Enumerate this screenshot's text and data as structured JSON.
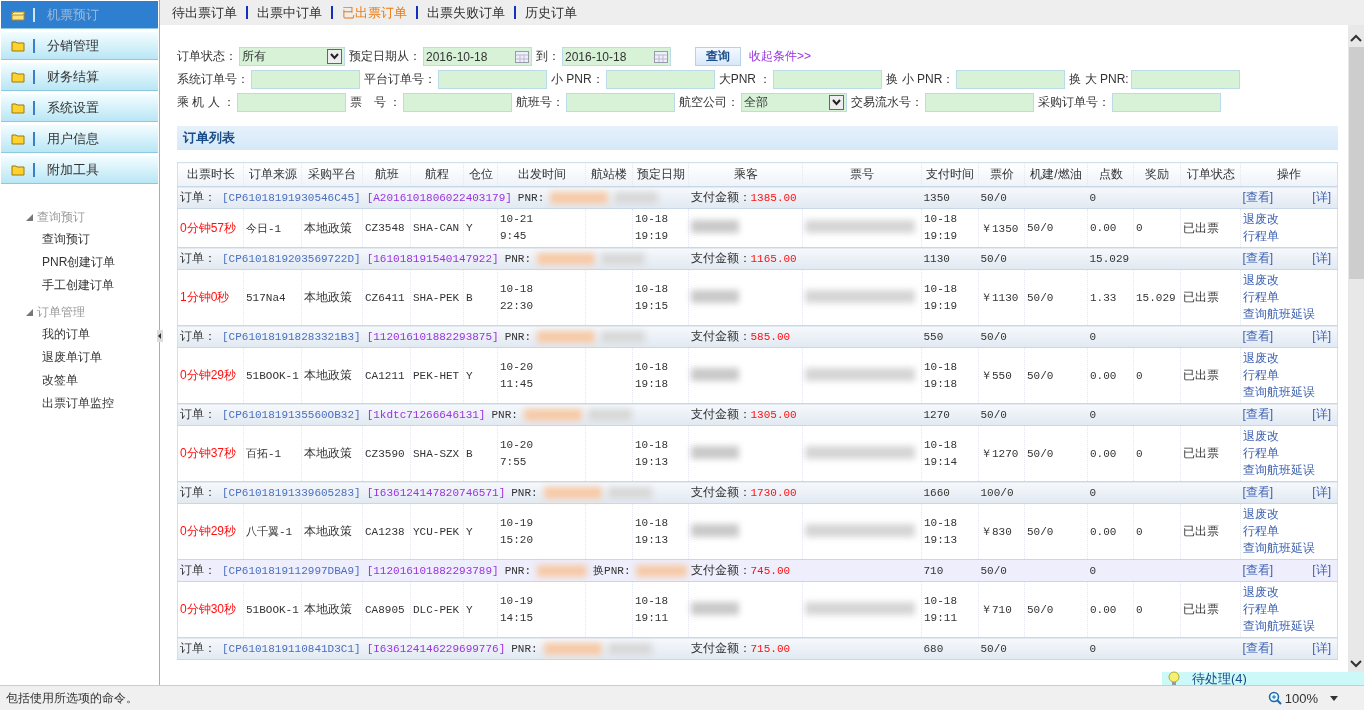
{
  "sidebar": {
    "nav": [
      {
        "label": "机票预订",
        "selected": true
      },
      {
        "label": "分销管理",
        "selected": false
      },
      {
        "label": "财务结算",
        "selected": false
      },
      {
        "label": "系统设置",
        "selected": false
      },
      {
        "label": "用户信息",
        "selected": false
      },
      {
        "label": "附加工具",
        "selected": false
      }
    ],
    "tree": [
      {
        "label": "查询预订",
        "expanded": true,
        "children": [
          {
            "label": "查询预订"
          },
          {
            "label": "PNR创建订单"
          },
          {
            "label": "手工创建订单"
          }
        ]
      },
      {
        "label": "订单管理",
        "expanded": true,
        "children": [
          {
            "label": "我的订单"
          },
          {
            "label": "退废单订单"
          },
          {
            "label": "改签单"
          },
          {
            "label": "出票订单监控"
          }
        ]
      }
    ]
  },
  "tabs": [
    {
      "label": "待出票订单",
      "selected": false
    },
    {
      "label": "出票中订单",
      "selected": false
    },
    {
      "label": "已出票订单",
      "selected": true
    },
    {
      "label": "出票失败订单",
      "selected": false
    },
    {
      "label": "历史订单",
      "selected": false
    }
  ],
  "filters": [
    [
      {
        "kind": "select",
        "label": "订单状态：",
        "value": "所有"
      },
      {
        "kind": "date",
        "label": "预定日期从：",
        "value": "2016-10-18"
      },
      {
        "kind": "date",
        "label": "到：",
        "value": "2016-10-18"
      },
      {
        "kind": "button",
        "label": "查询"
      },
      {
        "kind": "link",
        "label": "收起条件>>"
      }
    ],
    [
      {
        "kind": "text",
        "label": "系统订单号："
      },
      {
        "kind": "text",
        "label": "平台订单号："
      },
      {
        "kind": "text",
        "label": "小 PNR："
      },
      {
        "kind": "text",
        "label": "大PNR ："
      },
      {
        "kind": "text",
        "label": "换 小 PNR："
      },
      {
        "kind": "text",
        "label": "换 大 PNR:"
      }
    ],
    [
      {
        "kind": "text",
        "label": "乘 机 人 ："
      },
      {
        "kind": "text",
        "label": "票　号 ："
      },
      {
        "kind": "text",
        "label": "航班号："
      },
      {
        "kind": "select",
        "label": "航空公司：",
        "value": "全部"
      },
      {
        "kind": "text",
        "label": "交易流水号："
      },
      {
        "kind": "text",
        "label": "采购订单号："
      }
    ]
  ],
  "order_list": {
    "title": "订单列表",
    "columns": [
      "出票时长",
      "订单来源",
      "采购平台",
      "航班",
      "航程",
      "仓位",
      "出发时间",
      "航站楼",
      "预定日期",
      "乘客",
      "票号",
      "支付时间",
      "票价",
      "机建/燃油",
      "点数",
      "奖励",
      "订单状态",
      "操作"
    ],
    "orders": [
      {
        "highlighted": false,
        "order_label": "订单：",
        "order_no": "[CP61018191930546C45]",
        "platform_no": "[A2016101806022403179]",
        "pnr_label": "PNR:",
        "pay_label": "支付金额：",
        "pay_amount": "1385.00",
        "total": "1350",
        "fees": "50/0",
        "points": "0",
        "actions": [
          "[查看]",
          "[详]"
        ],
        "detail": {
          "duration": "0分钟57秒",
          "source": "今日-1",
          "platform": "本地政策",
          "flight": "CZ3548",
          "route": "SHA-CAN",
          "cabin": "Y",
          "depart": [
            "10-21",
            "9:45"
          ],
          "booked": [
            "10-18",
            "19:19"
          ],
          "paid": [
            "10-18",
            "19:19"
          ],
          "price": "￥1350",
          "fee": "50/0",
          "point": "0.00",
          "reward": "0",
          "status": "已出票",
          "actions": [
            "退废改",
            "行程单"
          ]
        }
      },
      {
        "highlighted": false,
        "order_label": "订单：",
        "order_no": "[CP6101819203569722D]",
        "platform_no": "[161018191540147922]",
        "pnr_label": "PNR:",
        "pay_label": "支付金额：",
        "pay_amount": "1165.00",
        "total": "1130",
        "fees": "50/0",
        "points": "15.029",
        "actions": [
          "[查看]",
          "[详]"
        ],
        "detail": {
          "duration": "1分钟0秒",
          "source": "517Na4",
          "platform": "本地政策",
          "flight": "CZ6411",
          "route": "SHA-PEK",
          "cabin": "B",
          "depart": [
            "10-18",
            "22:30"
          ],
          "booked": [
            "10-18",
            "19:15"
          ],
          "paid": [
            "10-18",
            "19:19"
          ],
          "price": "￥1130",
          "fee": "50/0",
          "point": "1.33",
          "reward": "15.029",
          "status": "已出票",
          "actions": [
            "退废改",
            "行程单",
            "查询航班延误"
          ]
        }
      },
      {
        "highlighted": false,
        "order_label": "订单：",
        "order_no": "[CP610181918283321B3]",
        "platform_no": "[112016101882293875]",
        "pnr_label": "PNR:",
        "pay_label": "支付金额：",
        "pay_amount": "585.00",
        "total": "550",
        "fees": "50/0",
        "points": "0",
        "actions": [
          "[查看]",
          "[详]"
        ],
        "detail": {
          "duration": "0分钟29秒",
          "source": "51BOOK-1",
          "platform": "本地政策",
          "flight": "CA1211",
          "route": "PEK-HET",
          "cabin": "Y",
          "depart": [
            "10-20",
            "11:45"
          ],
          "booked": [
            "10-18",
            "19:18"
          ],
          "paid": [
            "10-18",
            "19:18"
          ],
          "price": "￥550",
          "fee": "50/0",
          "point": "0.00",
          "reward": "0",
          "status": "已出票",
          "actions": [
            "退废改",
            "行程单",
            "查询航班延误"
          ]
        }
      },
      {
        "highlighted": false,
        "order_label": "订单：",
        "order_no": "[CP6101819135560OB32]",
        "platform_no": "[1kdtc71266646131]",
        "pnr_label": "PNR:",
        "pay_label": "支付金额：",
        "pay_amount": "1305.00",
        "total": "1270",
        "fees": "50/0",
        "points": "0",
        "actions": [
          "[查看]",
          "[详]"
        ],
        "detail": {
          "duration": "0分钟37秒",
          "source": "百拓-1",
          "platform": "本地政策",
          "flight": "CZ3590",
          "route": "SHA-SZX",
          "cabin": "B",
          "depart": [
            "10-20",
            "7:55"
          ],
          "booked": [
            "10-18",
            "19:13"
          ],
          "paid": [
            "10-18",
            "19:14"
          ],
          "price": "￥1270",
          "fee": "50/0",
          "point": "0.00",
          "reward": "0",
          "status": "已出票",
          "actions": [
            "退废改",
            "行程单",
            "查询航班延误"
          ]
        }
      },
      {
        "highlighted": false,
        "order_label": "订单：",
        "order_no": "[CP61018191339605283]",
        "platform_no": "[I636124147820746571]",
        "pnr_label": "PNR:",
        "pay_label": "支付金额：",
        "pay_amount": "1730.00",
        "total": "1660",
        "fees": "100/0",
        "points": "0",
        "actions": [
          "[查看]",
          "[详]"
        ],
        "detail": {
          "duration": "0分钟29秒",
          "source": "八千翼-1",
          "platform": "本地政策",
          "flight": "CA1238",
          "route": "YCU-PEK",
          "cabin": "Y",
          "depart": [
            "10-19",
            "15:20"
          ],
          "booked": [
            "10-18",
            "19:13"
          ],
          "paid": [
            "10-18",
            "19:13"
          ],
          "price": "￥830",
          "fee": "50/0",
          "point": "0.00",
          "reward": "0",
          "status": "已出票",
          "actions": [
            "退废改",
            "行程单",
            "查询航班延误"
          ]
        }
      },
      {
        "highlighted": true,
        "order_label": "订单：",
        "order_no": "[CP6101819112997DBA9]",
        "platform_no": "[112016101882293789]",
        "pnr_label": "PNR:",
        "alt_pnr_label": "换PNR:",
        "pay_label": "支付金额：",
        "pay_amount": "745.00",
        "total": "710",
        "fees": "50/0",
        "points": "0",
        "actions": [
          "[查看]",
          "[详]"
        ],
        "detail": {
          "duration": "0分钟30秒",
          "source": "51BOOK-1",
          "platform": "本地政策",
          "flight": "CA8905",
          "route": "DLC-PEK",
          "cabin": "Y",
          "depart": [
            "10-19",
            "14:15"
          ],
          "booked": [
            "10-18",
            "19:11"
          ],
          "paid": [
            "10-18",
            "19:11"
          ],
          "price": "￥710",
          "fee": "50/0",
          "point": "0.00",
          "reward": "0",
          "status": "已出票",
          "actions": [
            "退废改",
            "行程单",
            "查询航班延误"
          ]
        }
      },
      {
        "highlighted": false,
        "order_label": "订单：",
        "order_no": "[CP6101819110841D3C1]",
        "platform_no": "[I636124146229699776]",
        "pnr_label": "PNR:",
        "pay_label": "支付金额：",
        "pay_amount": "715.00",
        "total": "680",
        "fees": "50/0",
        "points": "0",
        "actions": [
          "[查看]",
          "[详]"
        ]
      }
    ]
  },
  "popup": {
    "label": "待处理(4)"
  },
  "status_bar": {
    "text": "包括使用所选项的命令。",
    "zoom": "100%"
  }
}
